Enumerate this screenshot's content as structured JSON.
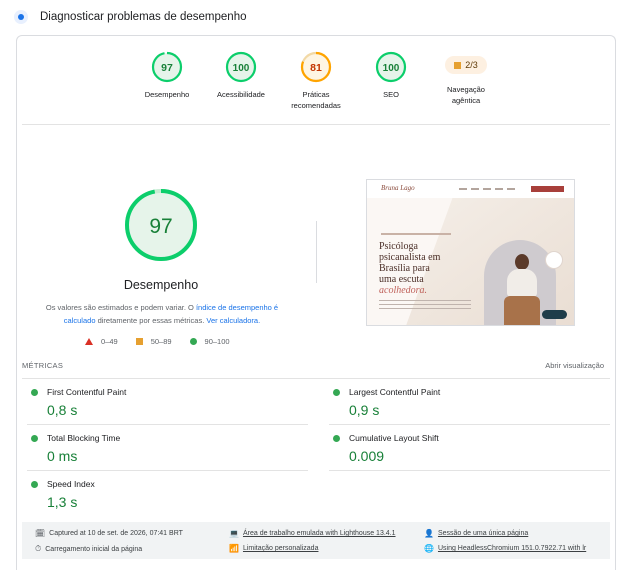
{
  "header": {
    "title": "Diagnosticar problemas de desempenho",
    "icon": "lighthouse-icon"
  },
  "gauges": [
    {
      "id": "desempenho",
      "score": "97",
      "label": "Desempenho",
      "color": "#0cce6b"
    },
    {
      "id": "acessibilidade",
      "score": "100",
      "label": "Acessibilidade",
      "color": "#0cce6b"
    },
    {
      "id": "praticas",
      "score": "81",
      "label_l1": "Práticas",
      "label_l2": "recomendadas",
      "color": "#ffa400"
    },
    {
      "id": "seo",
      "score": "100",
      "label": "SEO",
      "color": "#0cce6b"
    },
    {
      "id": "agentica",
      "pill": "2/3",
      "label_l1": "Navegação",
      "label_l2": "agêntica",
      "color": "#e6a030"
    }
  ],
  "main_score": {
    "score": "97",
    "title": "Desempenho",
    "desc_prefix": "Os valores são estimados e podem variar. O ",
    "desc_link1": "índice de desempenho é calculado",
    "desc_middle": " diretamente por essas métricas. ",
    "desc_link2": "Ver calculadora."
  },
  "legend": [
    {
      "shape": "triangle",
      "range": "0–49",
      "color": "#d93025"
    },
    {
      "shape": "square",
      "range": "50–89",
      "color": "#e6a030"
    },
    {
      "shape": "circle",
      "range": "90–100",
      "color": "#34a853"
    }
  ],
  "screenshot": {
    "logo": "Bruna Lago",
    "headline_1": "Psicóloga",
    "headline_2": "psicanalista em",
    "headline_3": "Brasília para",
    "headline_4": "uma escuta",
    "headline_accent": "acolhedora."
  },
  "metrics": {
    "title": "MÉTRICAS",
    "toggle": "Abrir visualização",
    "items": [
      {
        "label": "First Contentful Paint",
        "value": "0,8 s"
      },
      {
        "label": "Largest Contentful Paint",
        "value": "0,9 s"
      },
      {
        "label": "Total Blocking Time",
        "value": "0 ms"
      },
      {
        "label": "Cumulative Layout Shift",
        "value": "0.009"
      },
      {
        "label": "Speed Index",
        "value": "1,3 s"
      }
    ]
  },
  "footer": {
    "captured": "Captured at 10 de set. de 2026, 07:41 BRT",
    "initial_load": "Carregamento inicial da página",
    "emulated": "Área de trabalho emulada with Lighthouse 13.4.1",
    "throttling": "Limitação personalizada",
    "session": "Sessão de uma única página",
    "chromium": "Using HeadlessChromium 151.0.7922.71 with lr"
  }
}
